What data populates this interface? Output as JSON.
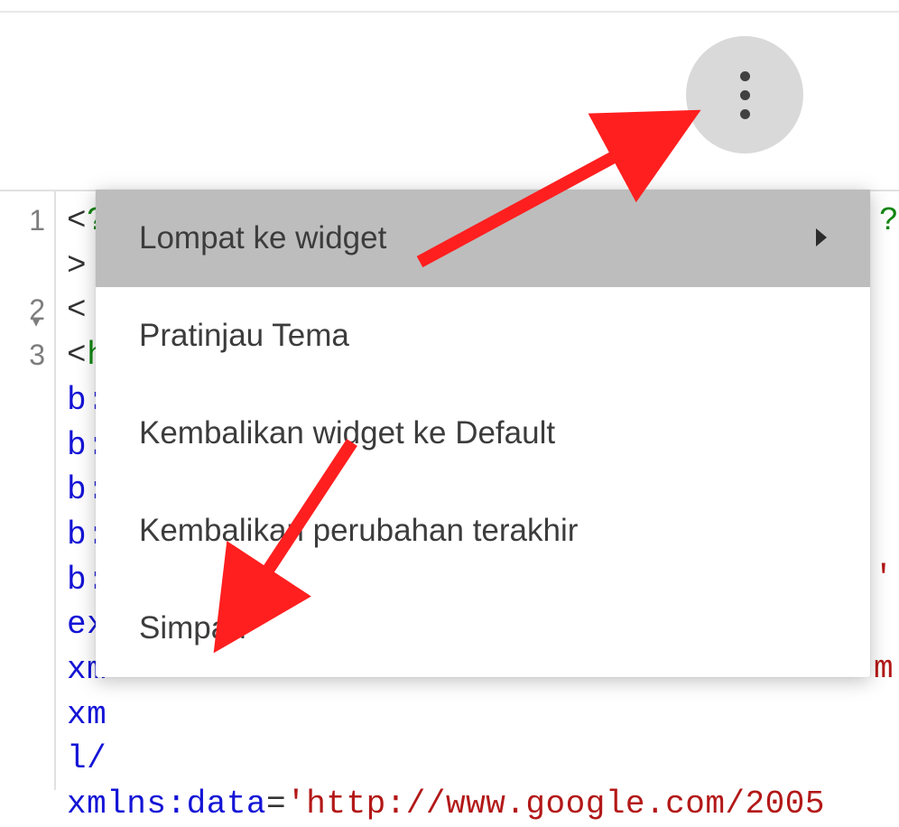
{
  "toolbar": {
    "more_icon": "more-vert"
  },
  "menu": {
    "items": [
      {
        "label": "Lompat ke widget",
        "has_submenu": true,
        "hovered": true
      },
      {
        "label": "Pratinjau Tema",
        "has_submenu": false,
        "hovered": false
      },
      {
        "label": "Kembalikan widget ke Default",
        "has_submenu": false,
        "hovered": false
      },
      {
        "label": "Kembalikan perubahan terakhir",
        "has_submenu": false,
        "hovered": false
      },
      {
        "label": "Simpan",
        "has_submenu": false,
        "hovered": false
      }
    ]
  },
  "editor": {
    "gutter": [
      "1",
      "2",
      "3"
    ],
    "fold_marker": "▾",
    "lines": [
      [
        {
          "cls": "c-punc",
          "t": "<"
        },
        {
          "cls": "c-tag",
          "t": "?"
        }
      ],
      [
        {
          "cls": "c-punc",
          "t": ">"
        }
      ],
      [
        {
          "cls": "c-punc",
          "t": "<"
        }
      ],
      [
        {
          "cls": "c-punc",
          "t": "<"
        },
        {
          "cls": "c-tag",
          "t": "h"
        }
      ],
      [
        {
          "cls": "c-attr",
          "t": "b:"
        }
      ],
      [
        {
          "cls": "c-attr",
          "t": "b:"
        }
      ],
      [
        {
          "cls": "c-attr",
          "t": "b:"
        }
      ],
      [
        {
          "cls": "c-attr",
          "t": "b:"
        }
      ],
      [
        {
          "cls": "c-attr",
          "t": "b:"
        }
      ],
      [
        {
          "cls": "c-attr",
          "t": "ex"
        },
        {
          "cls": "c-right c-val",
          "t": "'"
        }
      ],
      [
        {
          "cls": "c-attr",
          "t": "xm"
        }
      ],
      [
        {
          "cls": "c-attr",
          "t": "xm"
        },
        {
          "cls": "c-right c-val",
          "t": "m"
        }
      ],
      [
        {
          "cls": "c-attr",
          "t": "l/"
        }
      ],
      [
        {
          "cls": "c-attr",
          "t": "xmlns:data"
        },
        {
          "cls": "c-punc",
          "t": "="
        },
        {
          "cls": "c-val",
          "t": "'http://www.google.com/2005"
        }
      ]
    ],
    "right_edge_chars": {
      "2": "?",
      "10": "'",
      "12": "m"
    }
  },
  "annotations": {
    "arrow1": {
      "color": "#ff1f1f"
    },
    "arrow2": {
      "color": "#ff1f1f"
    }
  }
}
